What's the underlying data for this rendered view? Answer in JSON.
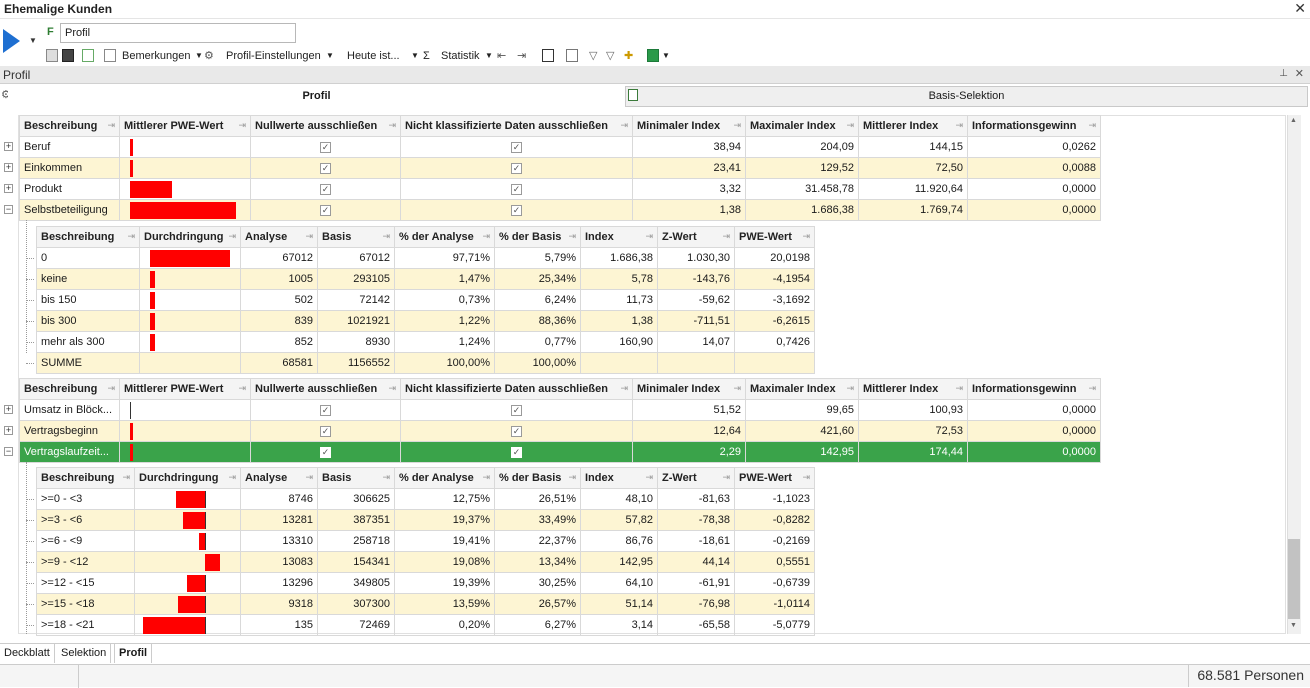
{
  "window": {
    "title": "Ehemalige Kunden"
  },
  "header": {
    "profile_input": "Profil"
  },
  "toolbar": {
    "remarks": "Bemerkungen",
    "profile_settings": "Profil-Einstellungen",
    "today": "Heute ist...",
    "statistic": "Statistik"
  },
  "panel": {
    "title": "Profil"
  },
  "tabs": {
    "profil": "Profil",
    "basis": "Basis-Selektion"
  },
  "main_columns": [
    "Beschreibung",
    "Mittlerer PWE-Wert",
    "Nullwerte ausschließen",
    "Nicht klassifizierte Daten ausschließen",
    "Minimaler Index",
    "Maximaler Index",
    "Mittlerer Index",
    "Informationsgewinn"
  ],
  "sub_columns": [
    "Beschreibung",
    "Durchdringung",
    "Analyse",
    "Basis",
    "% der Analyse",
    "% der Basis",
    "Index",
    "Z-Wert",
    "PWE-Wert"
  ],
  "group1_rows": [
    {
      "label": "Beruf",
      "min": "38,94",
      "max": "204,09",
      "mean": "144,15",
      "info": "0,0262",
      "pwe_bar": 0.02
    },
    {
      "label": "Einkommen",
      "min": "23,41",
      "max": "129,52",
      "mean": "72,50",
      "info": "0,0088",
      "pwe_bar": 0.02
    },
    {
      "label": "Produkt",
      "min": "3,32",
      "max": "31.458,78",
      "mean": "11.920,64",
      "info": "0,0000",
      "pwe_bar": 0.4
    },
    {
      "label": "Selbstbeteiligung",
      "min": "1,38",
      "max": "1.686,38",
      "mean": "1.769,74",
      "info": "0,0000",
      "pwe_bar": 1.0
    }
  ],
  "sub1_rows": [
    {
      "label": "0",
      "analyse": "67012",
      "basis": "67012",
      "pa": "97,71%",
      "pb": "5,79%",
      "index": "1.686,38",
      "z": "1.030,30",
      "pwe": "20,0198",
      "pen": 0.97
    },
    {
      "label": "keine",
      "analyse": "1005",
      "basis": "293105",
      "pa": "1,47%",
      "pb": "25,34%",
      "index": "5,78",
      "z": "-143,76",
      "pwe": "-4,1954",
      "pen": 0.05
    },
    {
      "label": "bis 150",
      "analyse": "502",
      "basis": "72142",
      "pa": "0,73%",
      "pb": "6,24%",
      "index": "11,73",
      "z": "-59,62",
      "pwe": "-3,1692",
      "pen": 0.05
    },
    {
      "label": "bis 300",
      "analyse": "839",
      "basis": "1021921",
      "pa": "1,22%",
      "pb": "88,36%",
      "index": "1,38",
      "z": "-711,51",
      "pwe": "-6,2615",
      "pen": 0.05
    },
    {
      "label": "mehr als 300",
      "analyse": "852",
      "basis": "8930",
      "pa": "1,24%",
      "pb": "0,77%",
      "index": "160,90",
      "z": "14,07",
      "pwe": "0,7426",
      "pen": 0.05
    },
    {
      "label": "SUMME",
      "analyse": "68581",
      "basis": "1156552",
      "pa": "100,00%",
      "pb": "100,00%",
      "index": "",
      "z": "",
      "pwe": "",
      "pen": 0
    }
  ],
  "group2_rows": [
    {
      "label": "Umsatz in Blöck...",
      "min": "51,52",
      "max": "99,65",
      "mean": "100,93",
      "info": "0,0000",
      "pwe_bar": 0
    },
    {
      "label": "Vertragsbeginn",
      "min": "12,64",
      "max": "421,60",
      "mean": "72,53",
      "info": "0,0000",
      "pwe_bar": 0.02
    },
    {
      "label": "Vertragslaufzeit...",
      "min": "2,29",
      "max": "142,95",
      "mean": "174,44",
      "info": "0,0000",
      "pwe_bar": 0.02
    }
  ],
  "sub2_rows": [
    {
      "label": ">=0 - <3",
      "analyse": "8746",
      "basis": "306625",
      "pa": "12,75%",
      "pb": "26,51%",
      "index": "48,10",
      "z": "-81,63",
      "pwe": "-1,1023",
      "pwe_val": -1.1023
    },
    {
      "label": ">=3 - <6",
      "analyse": "13281",
      "basis": "387351",
      "pa": "19,37%",
      "pb": "33,49%",
      "index": "57,82",
      "z": "-78,38",
      "pwe": "-0,8282",
      "pwe_val": -0.8282
    },
    {
      "label": ">=6 - <9",
      "analyse": "13310",
      "basis": "258718",
      "pa": "19,41%",
      "pb": "22,37%",
      "index": "86,76",
      "z": "-18,61",
      "pwe": "-0,2169",
      "pwe_val": -0.2169
    },
    {
      "label": ">=9 - <12",
      "analyse": "13083",
      "basis": "154341",
      "pa": "19,08%",
      "pb": "13,34%",
      "index": "142,95",
      "z": "44,14",
      "pwe": "0,5551",
      "pwe_val": 0.5551
    },
    {
      "label": ">=12 - <15",
      "analyse": "13296",
      "basis": "349805",
      "pa": "19,39%",
      "pb": "30,25%",
      "index": "64,10",
      "z": "-61,91",
      "pwe": "-0,6739",
      "pwe_val": -0.6739
    },
    {
      "label": ">=15 - <18",
      "analyse": "9318",
      "basis": "307300",
      "pa": "13,59%",
      "pb": "26,57%",
      "index": "51,14",
      "z": "-76,98",
      "pwe": "-1,0114",
      "pwe_val": -1.0114
    },
    {
      "label": ">=18 - <21",
      "analyse": "135",
      "basis": "72469",
      "pa": "0,20%",
      "pb": "6,27%",
      "index": "3,14",
      "z": "-65,58",
      "pwe": "-5,0779",
      "pwe_val": -5.0779
    }
  ],
  "bottom_tabs": [
    "Deckblatt",
    "Selektion",
    "Profil"
  ],
  "status": {
    "persons": "68.581 Personen"
  },
  "colors": {
    "bar": "#ff0000",
    "selected_row": "#3aa34a",
    "alt_row": "#fdf5d3",
    "play": "#1e6fd1"
  }
}
